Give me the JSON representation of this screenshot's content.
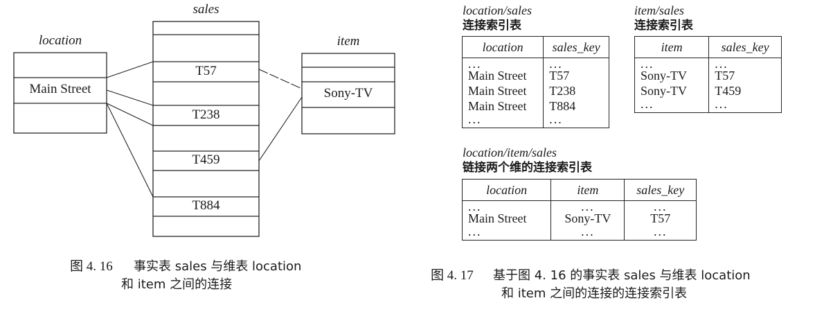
{
  "fig416": {
    "sales_label": "sales",
    "location_label": "location",
    "item_label": "item",
    "location_value": "Main Street",
    "item_value": "Sony-TV",
    "sales_rows": [
      "T57",
      "T238",
      "T459",
      "T884"
    ],
    "caption_num": "图 4. 16",
    "caption_line1": "事实表 sales 与维表 location",
    "caption_line2": "和 item 之间的连接"
  },
  "fig417": {
    "t1_title_en": "location/sales",
    "t1_title_zh": "连接索引表",
    "t1_headers": [
      "location",
      "sales_key"
    ],
    "t1_rows": [
      [
        "...",
        "..."
      ],
      [
        "Main Street",
        "T57"
      ],
      [
        "Main Street",
        "T238"
      ],
      [
        "Main Street",
        "T884"
      ],
      [
        "...",
        "..."
      ]
    ],
    "t2_title_en": "item/sales",
    "t2_title_zh": "连接索引表",
    "t2_headers": [
      "item",
      "sales_key"
    ],
    "t2_rows": [
      [
        "...",
        "..."
      ],
      [
        "Sony-TV",
        "T57"
      ],
      [
        "Sony-TV",
        "T459"
      ],
      [
        "...",
        "..."
      ]
    ],
    "t3_title_en": "location/item/sales",
    "t3_title_zh": "链接两个维的连接索引表",
    "t3_headers": [
      "location",
      "item",
      "sales_key"
    ],
    "t3_rows": [
      [
        "...",
        "...",
        "..."
      ],
      [
        "Main Street",
        "Sony-TV",
        "T57"
      ],
      [
        "...",
        "...",
        "..."
      ]
    ],
    "caption_num": "图 4. 17",
    "caption_line1": "基于图 4. 16 的事实表 sales 与维表 location",
    "caption_line2": "和 item 之间的连接的连接索引表"
  }
}
